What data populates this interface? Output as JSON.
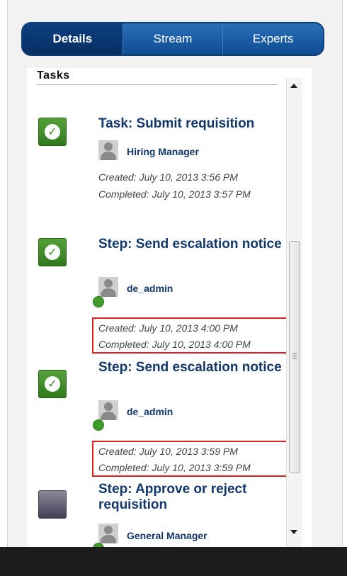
{
  "tabs": [
    {
      "label": "Details",
      "active": true
    },
    {
      "label": "Stream",
      "active": false
    },
    {
      "label": "Experts",
      "active": false
    }
  ],
  "section_title": "Tasks",
  "tasks": [
    {
      "title": "Task: Submit requisition",
      "status_icon": "check-icon",
      "user": "Hiring Manager",
      "created": "Created: July 10, 2013 3:56 PM",
      "completed": "Completed: July 10, 2013 3:57 PM"
    },
    {
      "title": "Step: Send escalation notice",
      "status_icon": "check-icon",
      "user": "de_admin",
      "created": "Created: July 10, 2013 4:00 PM",
      "completed": "Completed: July 10, 2013 4:00 PM"
    },
    {
      "title": "Step: Send escalation notice",
      "status_icon": "check-icon",
      "user": "de_admin",
      "created": "Created: July 10, 2013 3:59 PM",
      "completed": "Completed: July 10, 2013 3:59 PM"
    },
    {
      "title": "Step: Approve or reject requisition",
      "status_icon": "pending-icon",
      "user": "General Manager"
    }
  ],
  "colors": {
    "tab_bar": "#0e4b92",
    "title_text": "#12376a",
    "complete_green": "#3f9b2c",
    "highlight_red": "#e02020"
  }
}
